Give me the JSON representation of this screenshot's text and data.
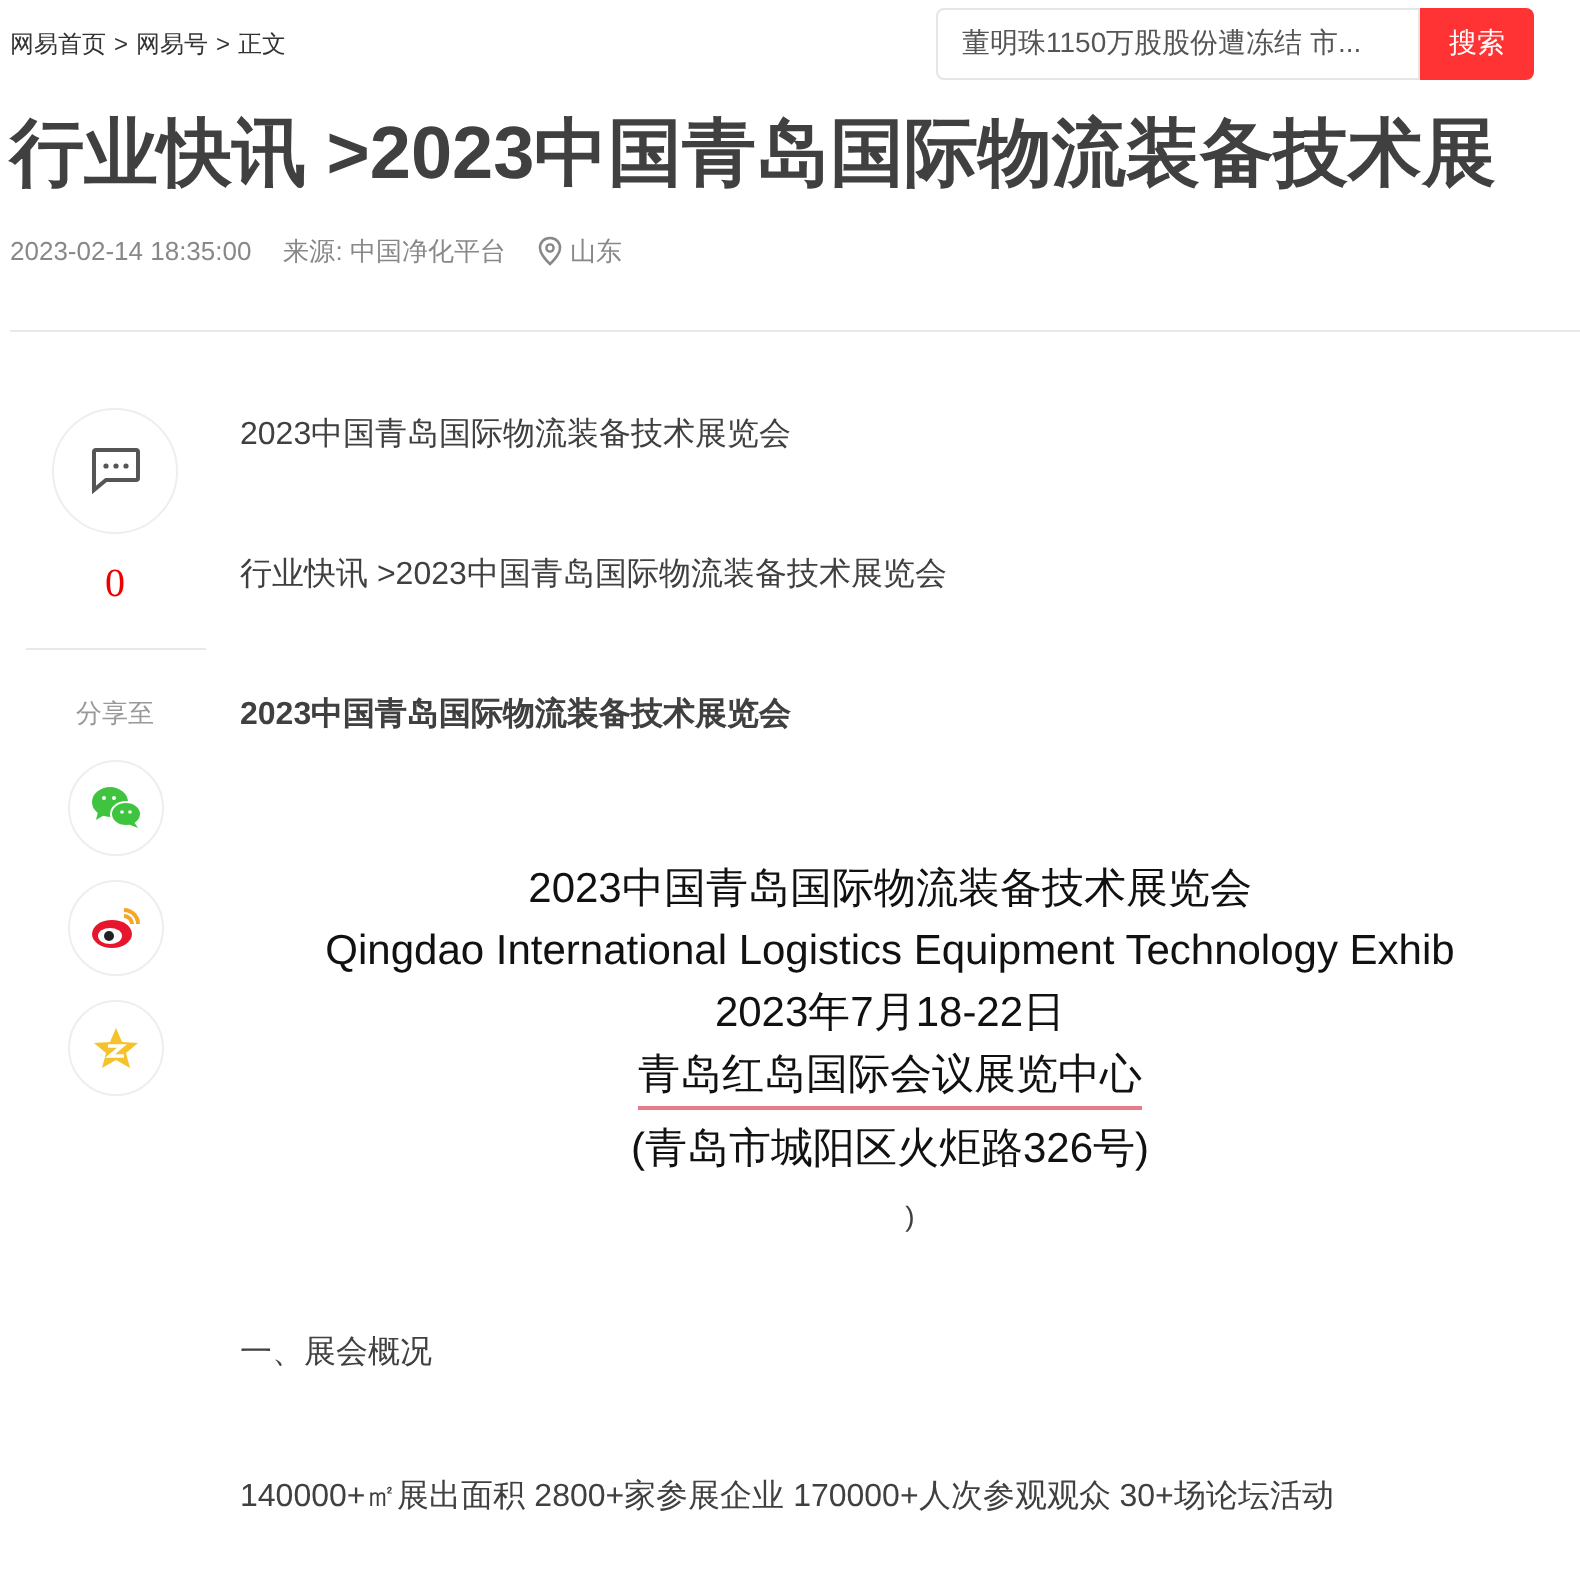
{
  "breadcrumb": [
    "网易首页",
    "网易号",
    "正文"
  ],
  "breadcrumb_separator": ">",
  "search": {
    "value": "董明珠1150万股股份遭冻结 市...",
    "button": "搜索"
  },
  "title": "行业快讯 >2023中国青岛国际物流装备技术展",
  "meta": {
    "time": "2023-02-14 18:35:00",
    "source": "来源: 中国净化平台",
    "location": "山东"
  },
  "sidebar": {
    "comment_count": "0",
    "share_label": "分享至",
    "share": [
      {
        "kind": "wechat"
      },
      {
        "kind": "weibo"
      },
      {
        "kind": "qzone"
      }
    ]
  },
  "article": [
    {
      "kind": "text",
      "text": "2023中国青岛国际物流装备技术展览会"
    },
    {
      "kind": "text",
      "text": "行业快讯 >2023中国青岛国际物流装备技术展览会"
    },
    {
      "kind": "bold",
      "text": "2023中国青岛国际物流装备技术展览会"
    },
    {
      "kind": "banner",
      "lines": [
        "2023中国青岛国际物流装备技术展览会",
        "Qingdao International Logistics Equipment Technology Exhib",
        "2023年7月18-22日",
        "青岛红岛国际会议展览中心",
        "(青岛市城阳区火炬路326号)"
      ]
    },
    {
      "kind": "center",
      "text": ")"
    },
    {
      "kind": "text",
      "text": "一、展会概况"
    },
    {
      "kind": "text",
      "text": "140000+㎡展出面积 2800+家参展企业 170000+人次参观观众 30+场论坛活动"
    }
  ]
}
